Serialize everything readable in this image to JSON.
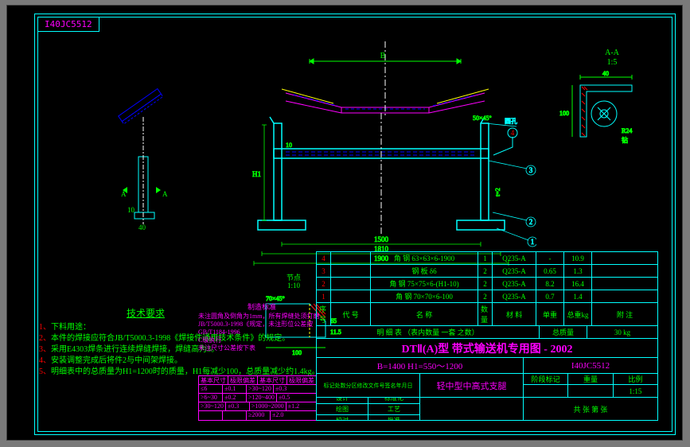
{
  "doc_id": "I40JC5512",
  "section_view": {
    "label": "A-A",
    "scale": "1:5"
  },
  "detail_view": {
    "label": "节点",
    "scale": "1:10"
  },
  "dimensions": {
    "main_width_1": "1500",
    "main_width_2": "1810",
    "main_width_3": "1900",
    "height_h1": "H1",
    "small_10": "10",
    "small_40": "40",
    "chamfer": "50×45°",
    "detail_chamfer": "70×45°",
    "detail_100": "100",
    "detail_65": "65",
    "detail_115": "11.5",
    "sec_40": "40",
    "sec_100": "100",
    "sec_r24": "R24",
    "sec_drill": "钻",
    "thk": "t=2",
    "label_b": "B",
    "label_a1": "A",
    "label_a2": "A",
    "side_40": "40",
    "side_10": "10"
  },
  "balloons": [
    "1",
    "2",
    "3",
    "4"
  ],
  "tech_req": {
    "title": "技术要求",
    "items": [
      "下料用途：",
      "本件的焊接应符合JB/T5000.3-1998《焊接件通用技术条件》的规定。",
      "采用E4303焊条进行连续焊缝焊接，焊缝高为3。",
      "安装调整完成后将件2与中间架焊接。",
      "明细表中的总质量为H1=1200时的质量，H1每减少100，总质量减少约1.4kg。"
    ]
  },
  "std_note": {
    "title": "制造标准",
    "lines": [
      "未注圆角及倒角为1mm，所有焊缝处须打磨",
      "JB/T5000.3-1998《规定，未注形位公差按GB/T1184-1996",
      "C级执行",
      "未注尺寸公差按下表"
    ]
  },
  "tolerance": {
    "headers": [
      "基本尺寸",
      "极限偏差",
      "基本尺寸",
      "极限偏差"
    ],
    "rows": [
      [
        "≤6",
        "±0.1",
        ">30~120",
        "±0.3"
      ],
      [
        ">6~30",
        "±0.2",
        ">120~400",
        "±0.5"
      ],
      [
        ">30~120",
        "±0.3",
        ">1000~2000",
        "±1.2"
      ],
      [
        "",
        "",
        "≥2000",
        "±2.0"
      ]
    ]
  },
  "bom": {
    "rows": [
      {
        "no": "4",
        "name": "角 钢 63×63×6-1900",
        "qty": "1",
        "mat": "Q235-A",
        "m1": "-",
        "m2": "10.9"
      },
      {
        "no": "3",
        "name": "钢 板 δ6",
        "qty": "2",
        "mat": "Q235-A",
        "m1": "0.65",
        "m2": "1.3"
      },
      {
        "no": "2",
        "name": "角 钢 75×75×6-(H1-10)",
        "qty": "2",
        "mat": "Q235-A",
        "m1": "8.2",
        "m2": "16.4"
      },
      {
        "no": "1",
        "name": "角 钢 70×70×6-100",
        "qty": "2",
        "mat": "Q235-A",
        "m1": "0.7",
        "m2": "1.4"
      }
    ],
    "header": {
      "no": "序号",
      "code": "代  号",
      "name": "名    称",
      "qty": "数量",
      "mat": "材    料",
      "m1": "单重",
      "m2": "总重kg",
      "note": "附  注"
    },
    "list_label": "明    细    表   （表内数量  一套  之数）",
    "total_mass_label": "总质量",
    "total_mass": "30 kg"
  },
  "title_block": {
    "main": "DTⅡ(A)型  带式输送机专用图 - 2002",
    "spec": "B=1400 H1=550～1200",
    "drawing_no": "I40JC5512",
    "mark_line": "标记处数分区修改文件号签名年月日",
    "part_name": "轻中型中高式支腿",
    "fields": {
      "design": "设计",
      "drawn": "绘图",
      "check": "校对",
      "std": "标准化",
      "proc": "工艺",
      "appr": "批准",
      "stage": "阶段标记",
      "mass": "重量",
      "scale": "比例",
      "scale_val": "1:15",
      "sheet": "共  张 第  张"
    }
  }
}
